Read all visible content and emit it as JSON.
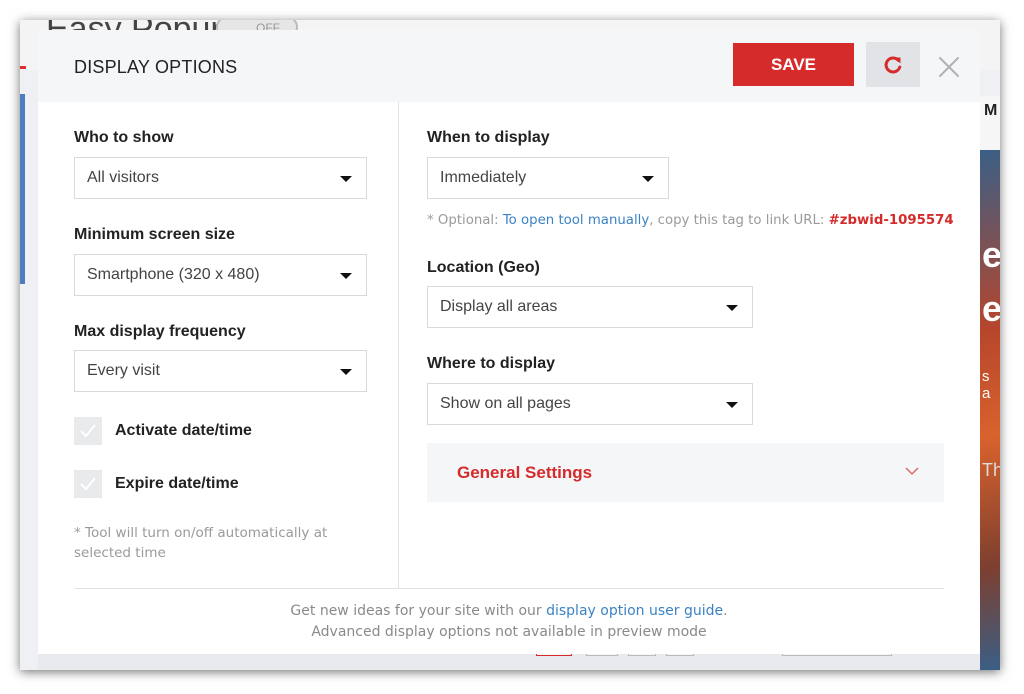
{
  "background": {
    "title": "Easy Popup",
    "toggle": "OFF",
    "right_letter": "M",
    "right_fragments": [
      "e",
      "e",
      "s a",
      "Th"
    ]
  },
  "modal": {
    "title": "DISPLAY OPTIONS",
    "save_label": "SAVE",
    "reset_icon": "refresh-icon",
    "close_icon": "close-icon"
  },
  "left": {
    "who_label": "Who to show",
    "who_value": "All visitors",
    "min_label": "Minimum screen size",
    "min_value": "Smartphone (320 x 480)",
    "freq_label": "Max display frequency",
    "freq_value": "Every visit",
    "activate_label": "Activate date/time",
    "expire_label": "Expire date/time",
    "note": "* Tool will turn on/off automatically at selected time"
  },
  "right": {
    "when_label": "When to display",
    "when_value": "Immediately",
    "optional_prefix": "* Optional: ",
    "optional_link": "To open tool manually",
    "optional_mid": ", copy this tag to link URL: ",
    "optional_tag": "#zbwid-1095574",
    "geo_label": "Location (Geo)",
    "geo_value": "Display all areas",
    "where_label": "Where to display",
    "where_value": "Show on all pages",
    "general_settings": "General Settings"
  },
  "footer": {
    "line1_prefix": "Get new ideas for your site with our ",
    "line1_link": "display option user guide",
    "line1_suffix": ".",
    "line2": "Advanced display options not available in preview mode"
  },
  "colors": {
    "accent_red": "#d52b2b",
    "link_blue": "#3b82c4",
    "header_bg": "#f5f6f8"
  }
}
